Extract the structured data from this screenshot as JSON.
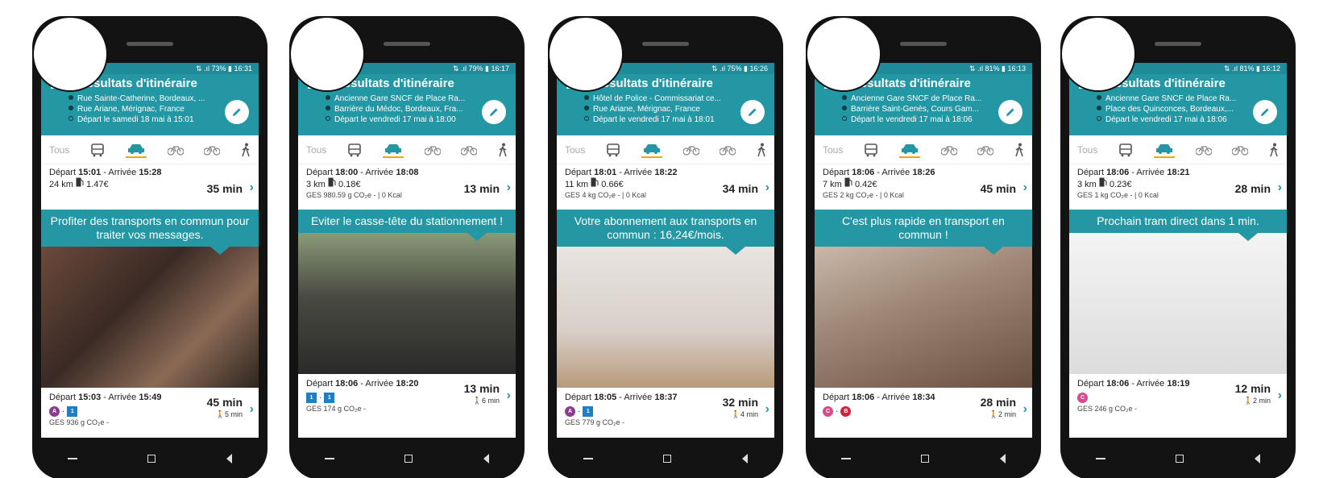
{
  "app_title": "Résultats d'itinéraire",
  "mode_all_label": "Tous",
  "colors": {
    "teal": "#2397a4",
    "accent": "#f0a800",
    "leaf": "#7cc242"
  },
  "icons": [
    "menu-icon",
    "edit-pencil-icon",
    "bus-icon",
    "car-icon",
    "bike-share-icon",
    "bicycle-icon",
    "walk-icon",
    "fuel-pump-icon",
    "leaf-icon",
    "flame-icon",
    "chevron-right-icon"
  ],
  "screens": [
    {
      "status": "⇅ .ıl 73% ▮ 16:31",
      "from": "Rue Sainte-Catherine, Bordeaux, ...",
      "to": "Rue Ariane, Mérignac, France",
      "depart_text": "Départ le samedi 18 mai à 15:01",
      "car_trip": {
        "depart_label": "Départ",
        "depart": "15:01",
        "arrive_label": "- Arrivée",
        "arrive": "15:28",
        "km": "24 km",
        "cost": "1.47€",
        "duration": "35 min",
        "ges": ""
      },
      "banner": "Profiter des transports en commun pour traiter vos messages.",
      "photo": "woman-with-phone",
      "tc_trip": {
        "text_depart": "Départ",
        "depart": "15:03",
        "text_arrive": "- Arrivée",
        "arrive": "15:49",
        "duration": "45 min",
        "walk": "5 min",
        "ges": "GES 936 g CO₂e -",
        "line1": "A",
        "line2": "1"
      }
    },
    {
      "status": "⇅ .ıl 79% ▮ 16:17",
      "from": "Ancienne Gare SNCF de Place Ra...",
      "to": "Barrière du Médoc, Bordeaux, Fra...",
      "depart_text": "Départ le vendredi 17 mai à 18:00",
      "car_trip": {
        "depart_label": "Départ",
        "depart": "18:00",
        "arrive_label": "- Arrivée",
        "arrive": "18:08",
        "km": "3 km",
        "cost": "0.18€",
        "duration": "13 min",
        "ges": "GES 980.59 g CO₂e -  | 0 Kcal"
      },
      "banner": "Eviter le casse-tête du stationnement !",
      "photo": "stressed-driver",
      "tc_trip": {
        "text_depart": "Départ",
        "depart": "18:06",
        "text_arrive": "- Arrivée",
        "arrive": "18:20",
        "duration": "13 min",
        "walk": "6 min",
        "ges": "GES 174 g CO₂e -",
        "line1": "1",
        "line2": "1"
      }
    },
    {
      "status": "⇅ .ıl 75% ▮ 16:26",
      "from": "Hôtel de Police - Commissariat ce...",
      "to": "Rue Ariane, Mérignac, France",
      "depart_text": "Départ le vendredi 17 mai à 18:01",
      "car_trip": {
        "depart_label": "Départ",
        "depart": "18:01",
        "arrive_label": "- Arrivée",
        "arrive": "18:22",
        "km": "11 km",
        "cost": "0.66€",
        "duration": "34 min",
        "ges": "GES 4 kg CO₂e -  | 0 Kcal"
      },
      "banner": "Votre abonnement aux transports en commun : 16,24€/mois.",
      "photo": "piggy-bank",
      "tc_trip": {
        "text_depart": "Départ",
        "depart": "18:05",
        "text_arrive": "- Arrivée",
        "arrive": "18:37",
        "duration": "32 min",
        "walk": "4 min",
        "ges": "GES 779 g CO₂e -",
        "line1": "A",
        "line2": "1"
      }
    },
    {
      "status": "⇅ .ıl 81% ▮ 16:13",
      "from": "Ancienne Gare SNCF de Place Ra...",
      "to": "Barrière Saint-Genès, Cours Gam...",
      "depart_text": "Départ le vendredi 17 mai à 18:06",
      "car_trip": {
        "depart_label": "Départ",
        "depart": "18:06",
        "arrive_label": "- Arrivée",
        "arrive": "18:26",
        "km": "7 km",
        "cost": "0.42€",
        "duration": "45 min",
        "ges": "GES 2 kg CO₂e -  | 0 Kcal"
      },
      "banner": "C'est plus rapide en transport en commun !",
      "photo": "hands-with-watch",
      "tc_trip": {
        "text_depart": "Départ",
        "depart": "18:06",
        "text_arrive": "- Arrivée",
        "arrive": "18:34",
        "duration": "28 min",
        "walk": "2 min",
        "ges": "",
        "line1": "C",
        "line2": "B"
      }
    },
    {
      "status": "⇅ .ıl 81% ▮ 16:12",
      "from": "Ancienne Gare SNCF de Place Ra...",
      "to": "Place des Quinconces, Bordeaux,...",
      "depart_text": "Départ le vendredi 17 mai à 18:06",
      "car_trip": {
        "depart_label": "Départ",
        "depart": "18:06",
        "arrive_label": "- Arrivée",
        "arrive": "18:21",
        "km": "3 km",
        "cost": "0.23€",
        "duration": "28 min",
        "ges": "GES 1 kg CO₂e -  | 0 Kcal"
      },
      "banner": "Prochain tram direct dans 1 min.",
      "photo": "maze-drawing",
      "tc_trip": {
        "text_depart": "Départ",
        "depart": "18:06",
        "text_arrive": "- Arrivée",
        "arrive": "18:19",
        "duration": "12 min",
        "walk": "2 min",
        "ges": "GES 246 g CO₂e -",
        "line1": "C",
        "line2": ""
      }
    }
  ]
}
